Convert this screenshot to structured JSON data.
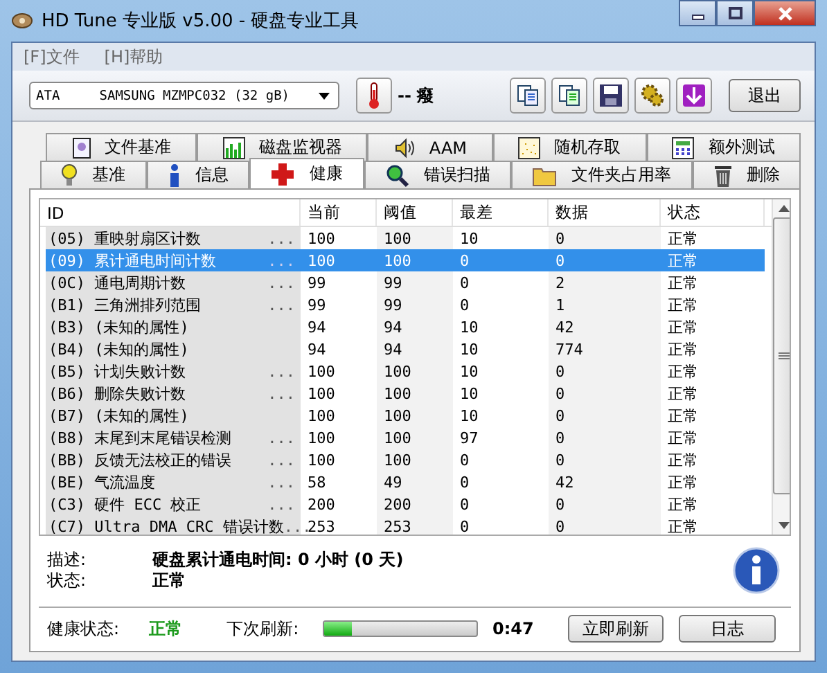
{
  "window": {
    "title": "HD Tune 专业版 v5.00 - 硬盘专业工具"
  },
  "menu": [
    "[F]文件",
    "[H]帮助"
  ],
  "toolbar": {
    "drive": "ATA     SAMSUNG MZMPC032 (32 gB)",
    "temperature": "--",
    "unit": "癈",
    "exit": "退出"
  },
  "tabs_top": [
    {
      "label": "文件基准",
      "kind": "doc",
      "selected": false
    },
    {
      "label": "磁盘监视器",
      "kind": "bars",
      "selected": false
    },
    {
      "label": "AAM",
      "kind": "speaker",
      "selected": false
    },
    {
      "label": "随机存取",
      "kind": "dots",
      "selected": false
    },
    {
      "label": "额外测试",
      "kind": "calc",
      "selected": false
    }
  ],
  "tabs_bottom": [
    {
      "label": "基准",
      "kind": "bulb",
      "selected": false
    },
    {
      "label": "信息",
      "kind": "info",
      "selected": false
    },
    {
      "label": "健康",
      "kind": "cross",
      "selected": true
    },
    {
      "label": "错误扫描",
      "kind": "magnifier",
      "selected": false
    },
    {
      "label": "文件夹占用率",
      "kind": "folder",
      "selected": false
    },
    {
      "label": "删除",
      "kind": "trash",
      "selected": false
    }
  ],
  "table": {
    "columns": [
      "ID",
      "当前",
      "阈值",
      "最差",
      "数据",
      "状态"
    ],
    "rows": [
      {
        "id": "(05) 重映射扇区计数",
        "more": "...",
        "current": "100",
        "threshold": "100",
        "worst": "10",
        "data": "0",
        "status": "正常",
        "selected": false
      },
      {
        "id": "(09) 累计通电时间计数",
        "more": "...",
        "current": "100",
        "threshold": "100",
        "worst": "0",
        "data": "0",
        "status": "正常",
        "selected": true
      },
      {
        "id": "(0C) 通电周期计数",
        "more": "...",
        "current": "99",
        "threshold": "99",
        "worst": "0",
        "data": "2",
        "status": "正常",
        "selected": false
      },
      {
        "id": "(B1) 三角洲排列范围",
        "more": "...",
        "current": "99",
        "threshold": "99",
        "worst": "0",
        "data": "1",
        "status": "正常",
        "selected": false
      },
      {
        "id": "(B3) (未知的属性)",
        "current": "94",
        "threshold": "94",
        "worst": "10",
        "data": "42",
        "status": "正常",
        "selected": false
      },
      {
        "id": "(B4) (未知的属性)",
        "current": "94",
        "threshold": "94",
        "worst": "10",
        "data": "774",
        "status": "正常",
        "selected": false
      },
      {
        "id": "(B5) 计划失败计数",
        "more": "...",
        "current": "100",
        "threshold": "100",
        "worst": "10",
        "data": "0",
        "status": "正常",
        "selected": false
      },
      {
        "id": "(B6) 删除失败计数",
        "more": "...",
        "current": "100",
        "threshold": "100",
        "worst": "10",
        "data": "0",
        "status": "正常",
        "selected": false
      },
      {
        "id": "(B7) (未知的属性)",
        "current": "100",
        "threshold": "100",
        "worst": "10",
        "data": "0",
        "status": "正常",
        "selected": false
      },
      {
        "id": "(B8) 末尾到末尾错误检测",
        "more": "...",
        "current": "100",
        "threshold": "100",
        "worst": "97",
        "data": "0",
        "status": "正常",
        "selected": false
      },
      {
        "id": "(BB) 反馈无法校正的错误",
        "more": "...",
        "current": "100",
        "threshold": "100",
        "worst": "0",
        "data": "0",
        "status": "正常",
        "selected": false
      },
      {
        "id": "(BE) 气流温度",
        "more": "...",
        "current": "58",
        "threshold": "49",
        "worst": "0",
        "data": "42",
        "status": "正常",
        "selected": false
      },
      {
        "id": "(C3) 硬件 ECC 校正",
        "more": "...",
        "current": "200",
        "threshold": "200",
        "worst": "0",
        "data": "0",
        "status": "正常",
        "selected": false
      },
      {
        "id": "(C7) Ultra DMA CRC 错误计数",
        "more": "...",
        "current": "253",
        "threshold": "253",
        "worst": "0",
        "data": "0",
        "status": "正常",
        "selected": false
      }
    ]
  },
  "details": [
    {
      "label": "描述:",
      "value": "硬盘累计通电时间: 0 小时 (0 天)"
    },
    {
      "label": "状态:",
      "value": "正常"
    }
  ],
  "status_bar": {
    "label": "健康状态:",
    "value": "正常",
    "refresh_label": "下次刷新:",
    "level": 0.18,
    "time": "0:47",
    "buttons": [
      "立即刷新",
      "日志"
    ]
  }
}
